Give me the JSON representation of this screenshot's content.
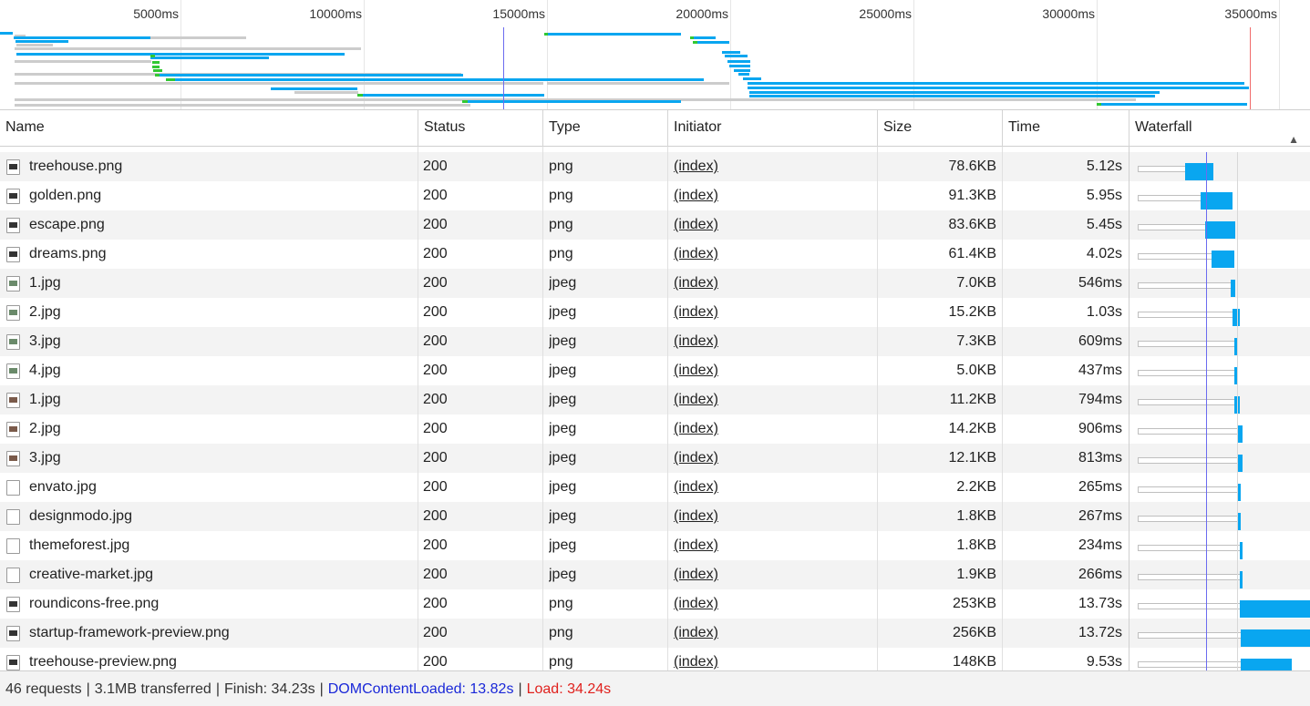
{
  "overview": {
    "ticks": [
      "5000ms",
      "10000ms",
      "15000ms",
      "20000ms",
      "25000ms",
      "30000ms",
      "35000ms"
    ],
    "dom_content_loaded_color": "#6b6bf0",
    "load_color": "#f06b6b"
  },
  "columns": {
    "name": "Name",
    "status": "Status",
    "type": "Type",
    "initiator": "Initiator",
    "size": "Size",
    "time": "Time",
    "waterfall": "Waterfall"
  },
  "rows": [
    {
      "name": "treehouse.png",
      "status": "200",
      "type": "png",
      "initiator": "(index)",
      "size": "78.6KB",
      "time": "5.12s",
      "icon": "image-icon"
    },
    {
      "name": "golden.png",
      "status": "200",
      "type": "png",
      "initiator": "(index)",
      "size": "91.3KB",
      "time": "5.95s",
      "icon": "image-icon"
    },
    {
      "name": "escape.png",
      "status": "200",
      "type": "png",
      "initiator": "(index)",
      "size": "83.6KB",
      "time": "5.45s",
      "icon": "image-icon"
    },
    {
      "name": "dreams.png",
      "status": "200",
      "type": "png",
      "initiator": "(index)",
      "size": "61.4KB",
      "time": "4.02s",
      "icon": "image-icon"
    },
    {
      "name": "1.jpg",
      "status": "200",
      "type": "jpeg",
      "initiator": "(index)",
      "size": "7.0KB",
      "time": "546ms",
      "icon": "photo-icon"
    },
    {
      "name": "2.jpg",
      "status": "200",
      "type": "jpeg",
      "initiator": "(index)",
      "size": "15.2KB",
      "time": "1.03s",
      "icon": "photo-icon"
    },
    {
      "name": "3.jpg",
      "status": "200",
      "type": "jpeg",
      "initiator": "(index)",
      "size": "7.3KB",
      "time": "609ms",
      "icon": "photo-icon"
    },
    {
      "name": "4.jpg",
      "status": "200",
      "type": "jpeg",
      "initiator": "(index)",
      "size": "5.0KB",
      "time": "437ms",
      "icon": "photo-icon"
    },
    {
      "name": "1.jpg",
      "status": "200",
      "type": "jpeg",
      "initiator": "(index)",
      "size": "11.2KB",
      "time": "794ms",
      "icon": "portrait-icon"
    },
    {
      "name": "2.jpg",
      "status": "200",
      "type": "jpeg",
      "initiator": "(index)",
      "size": "14.2KB",
      "time": "906ms",
      "icon": "portrait-icon"
    },
    {
      "name": "3.jpg",
      "status": "200",
      "type": "jpeg",
      "initiator": "(index)",
      "size": "12.1KB",
      "time": "813ms",
      "icon": "portrait-icon"
    },
    {
      "name": "envato.jpg",
      "status": "200",
      "type": "jpeg",
      "initiator": "(index)",
      "size": "2.2KB",
      "time": "265ms",
      "icon": "blank-file-icon"
    },
    {
      "name": "designmodo.jpg",
      "status": "200",
      "type": "jpeg",
      "initiator": "(index)",
      "size": "1.8KB",
      "time": "267ms",
      "icon": "blank-file-icon"
    },
    {
      "name": "themeforest.jpg",
      "status": "200",
      "type": "jpeg",
      "initiator": "(index)",
      "size": "1.8KB",
      "time": "234ms",
      "icon": "blank-file-icon"
    },
    {
      "name": "creative-market.jpg",
      "status": "200",
      "type": "jpeg",
      "initiator": "(index)",
      "size": "1.9KB",
      "time": "266ms",
      "icon": "blank-file-icon"
    },
    {
      "name": "roundicons-free.png",
      "status": "200",
      "type": "png",
      "initiator": "(index)",
      "size": "253KB",
      "time": "13.73s",
      "icon": "image-icon"
    },
    {
      "name": "startup-framework-preview.png",
      "status": "200",
      "type": "png",
      "initiator": "(index)",
      "size": "256KB",
      "time": "13.72s",
      "icon": "image-icon"
    },
    {
      "name": "treehouse-preview.png",
      "status": "200",
      "type": "png",
      "initiator": "(index)",
      "size": "148KB",
      "time": "9.53s",
      "icon": "image-icon"
    }
  ],
  "status_bar": {
    "requests": "46 requests",
    "transferred": "3.1MB transferred",
    "finish": "Finish: 34.23s",
    "dom_content_loaded": "DOMContentLoaded: 13.82s",
    "load": "Load: 34.24s",
    "separator": "|"
  }
}
